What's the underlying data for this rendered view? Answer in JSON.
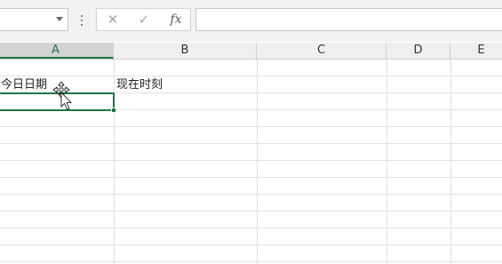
{
  "formula_bar": {
    "cancel_icon": "✕",
    "enter_icon": "✓",
    "fx_label": "fx",
    "formula_value": ""
  },
  "columns": [
    {
      "label": "A"
    },
    {
      "label": "B"
    },
    {
      "label": "C"
    },
    {
      "label": "D"
    },
    {
      "label": "E"
    }
  ],
  "cells": {
    "A2": "今日日期",
    "B2": "现在时刻"
  },
  "colors": {
    "selection": "#217346",
    "header_bg": "#efefef",
    "gridline": "#e1e1e1"
  }
}
